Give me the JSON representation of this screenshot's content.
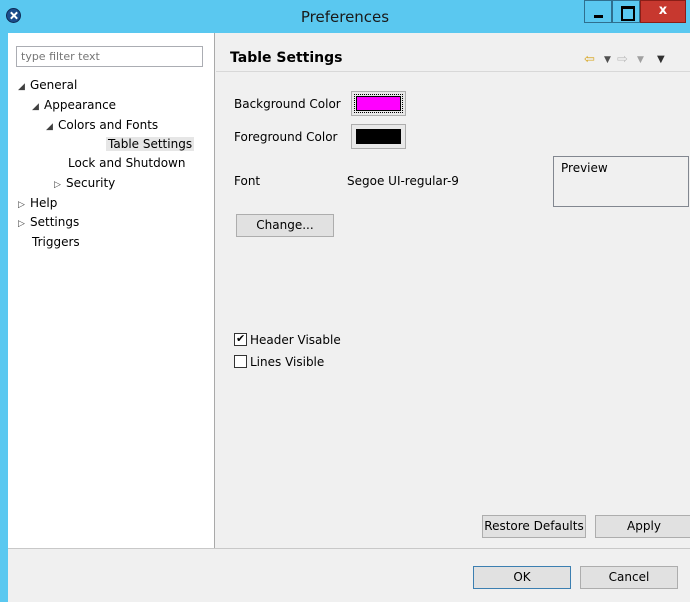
{
  "window": {
    "title": "Preferences",
    "close_glyph": "x"
  },
  "filter": {
    "placeholder": "type filter text"
  },
  "tree": [
    {
      "label": "General",
      "arrow": "◢"
    },
    {
      "label": "Appearance",
      "arrow": "◢"
    },
    {
      "label": "Colors and Fonts",
      "arrow": "◢"
    },
    {
      "label": "Table Settings",
      "arrow": ""
    },
    {
      "label": "Lock and Shutdown",
      "arrow": ""
    },
    {
      "label": "Security",
      "arrow": "▷"
    },
    {
      "label": "Help",
      "arrow": "▷"
    },
    {
      "label": "Settings",
      "arrow": "▷"
    },
    {
      "label": "Triggers",
      "arrow": ""
    }
  ],
  "page": {
    "title": "Table Settings",
    "nav": {
      "back": "⇦",
      "back_drop": "▼",
      "forward": "⇨",
      "forward_drop": "▼",
      "menu": "▼"
    },
    "background_color_label": "Background Color",
    "background_color": "#ff00ff",
    "foreground_color_label": "Foreground Color",
    "foreground_color": "#000000",
    "font_label": "Font",
    "font_value": "Segoe UI-regular-9",
    "preview_label": "Preview",
    "change_button": "Change...",
    "header_visible_label": "Header Visable",
    "header_visible_checked": true,
    "lines_visible_label": "Lines Visible",
    "lines_visible_checked": false,
    "restore_defaults_button": "Restore Defaults",
    "apply_button": "Apply"
  },
  "footer": {
    "ok_button": "OK",
    "cancel_button": "Cancel"
  }
}
